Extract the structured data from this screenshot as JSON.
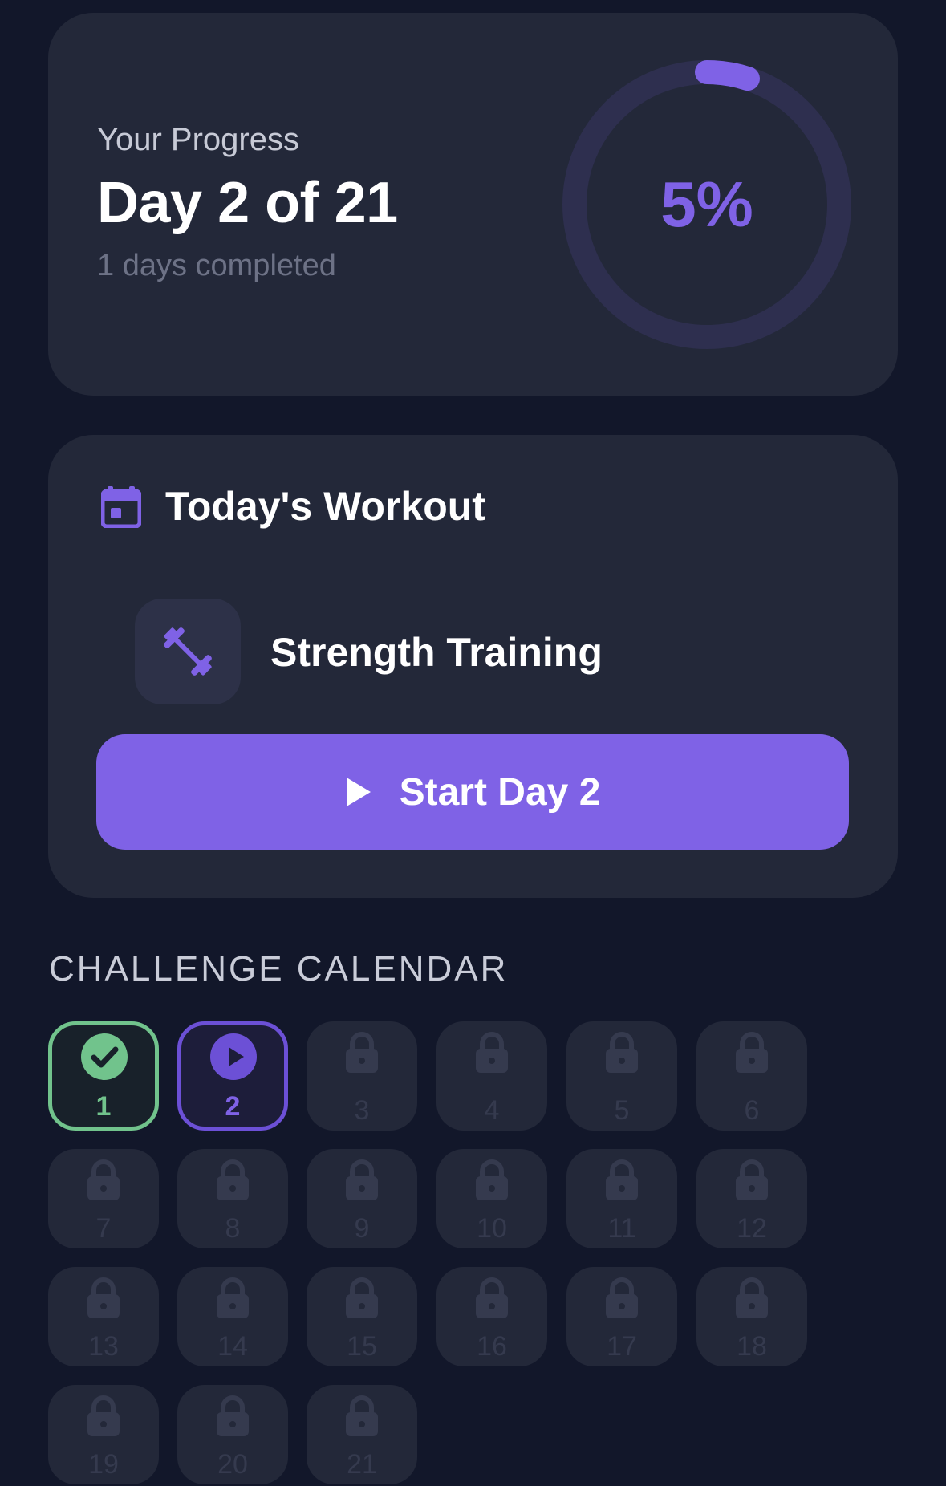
{
  "progress": {
    "label": "Your Progress",
    "title": "Day 2 of 21",
    "subtitle": "1 days completed",
    "percent_text": "5%",
    "percent_value": 5
  },
  "workout": {
    "title": "Today's Workout",
    "icon": "calendar-icon",
    "exercise": {
      "name": "Strength Training",
      "icon": "dumbbell-icon"
    },
    "start_button_label": "Start Day 2",
    "start_button_icon": "play-icon"
  },
  "calendar": {
    "title": "CHALLENGE CALENDAR",
    "days": [
      {
        "number": "1",
        "status": "completed"
      },
      {
        "number": "2",
        "status": "current"
      },
      {
        "number": "3",
        "status": "locked"
      },
      {
        "number": "4",
        "status": "locked"
      },
      {
        "number": "5",
        "status": "locked"
      },
      {
        "number": "6",
        "status": "locked"
      },
      {
        "number": "7",
        "status": "locked"
      },
      {
        "number": "8",
        "status": "locked"
      },
      {
        "number": "9",
        "status": "locked"
      },
      {
        "number": "10",
        "status": "locked"
      },
      {
        "number": "11",
        "status": "locked"
      },
      {
        "number": "12",
        "status": "locked"
      },
      {
        "number": "13",
        "status": "locked"
      },
      {
        "number": "14",
        "status": "locked"
      },
      {
        "number": "15",
        "status": "locked"
      },
      {
        "number": "16",
        "status": "locked"
      },
      {
        "number": "17",
        "status": "locked"
      },
      {
        "number": "18",
        "status": "locked"
      },
      {
        "number": "19",
        "status": "locked"
      },
      {
        "number": "20",
        "status": "locked"
      },
      {
        "number": "21",
        "status": "locked"
      }
    ]
  },
  "colors": {
    "background": "#12172a",
    "card": "#232839",
    "accent": "#7f62e6",
    "success": "#71c38c",
    "muted": "#6d7286"
  }
}
